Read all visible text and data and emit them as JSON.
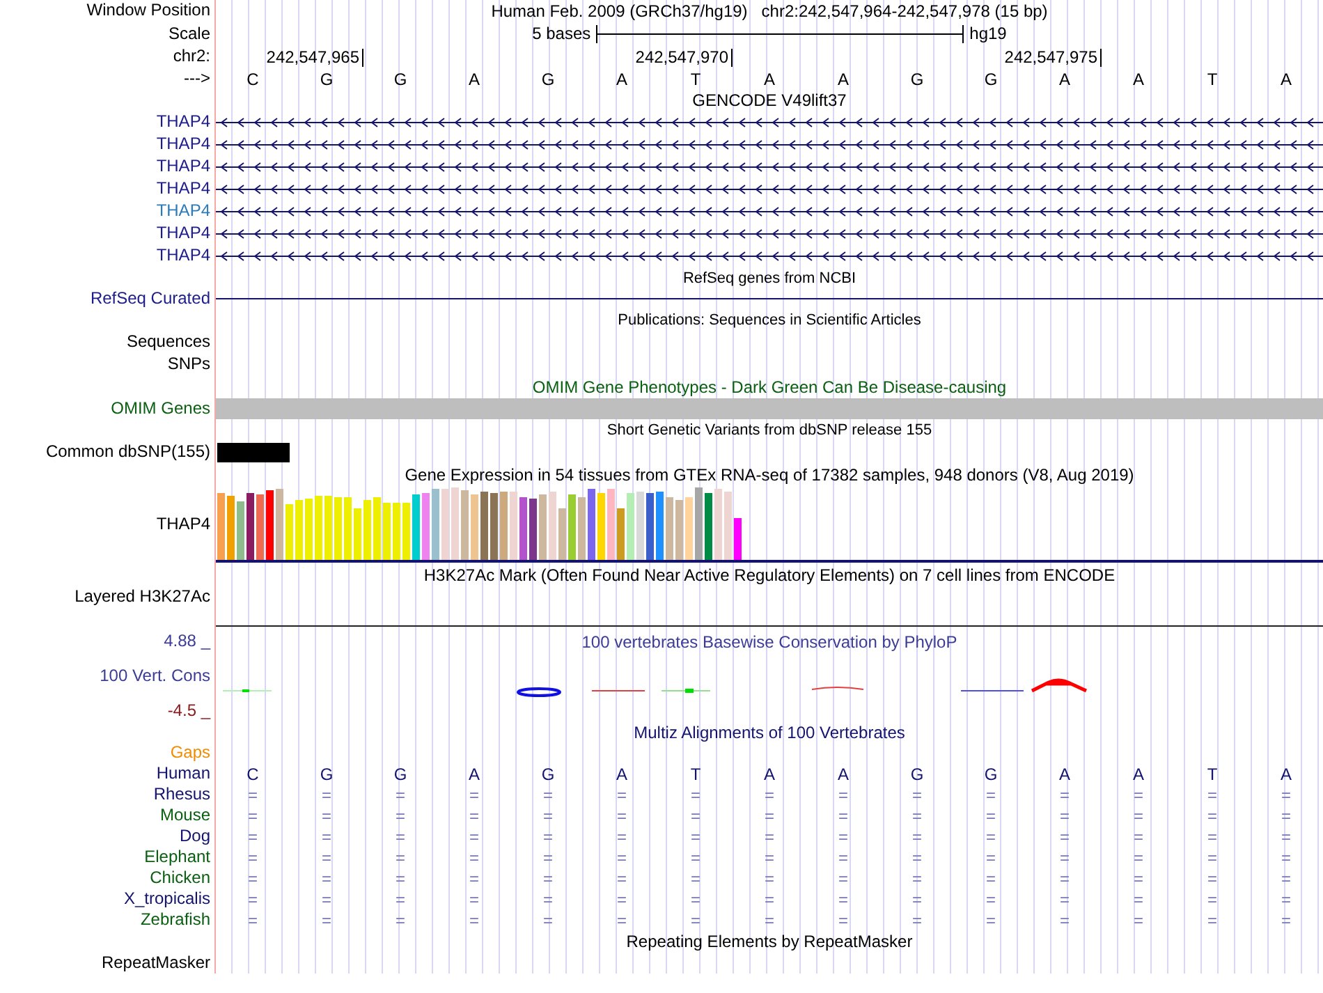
{
  "header": {
    "window_position_label": "Window Position",
    "assembly": "Human Feb. 2009 (GRCh37/hg19)",
    "position": "chr2:242,547,964-242,547,978 (15 bp)",
    "scale_label": "Scale",
    "scale_text": "5 bases",
    "scale_db": "hg19",
    "chrom_label": "chr2:",
    "ticks": [
      "242,547,965",
      "242,547,970",
      "242,547,975"
    ],
    "strand_label": "--->",
    "bases": [
      "C",
      "G",
      "G",
      "A",
      "G",
      "A",
      "T",
      "A",
      "A",
      "G",
      "G",
      "A",
      "A",
      "T",
      "A"
    ]
  },
  "tracks": [
    {
      "kind": "gene",
      "title": "GENCODE V49lift37",
      "color": "#000000",
      "rows": [
        {
          "label": "THAP4",
          "color": "#1c1c8a"
        },
        {
          "label": "THAP4",
          "color": "#1c1c8a"
        },
        {
          "label": "THAP4",
          "color": "#1c1c8a"
        },
        {
          "label": "THAP4",
          "color": "#1c1c8a"
        },
        {
          "label": "THAP4",
          "color": "#2b7bb9"
        },
        {
          "label": "THAP4",
          "color": "#1c1c8a"
        },
        {
          "label": "THAP4",
          "color": "#1c1c8a"
        }
      ]
    },
    {
      "kind": "line",
      "title": "RefSeq genes from NCBI",
      "color": "#000000",
      "rows": [
        {
          "label": "RefSeq Curated",
          "color": "#1c1c8a"
        }
      ]
    },
    {
      "kind": "empty",
      "title": "Publications: Sequences in Scientific Articles",
      "color": "#000000",
      "rows": [
        {
          "label": "Sequences",
          "color": "#000000"
        },
        {
          "label": "SNPs",
          "color": "#000000"
        }
      ]
    },
    {
      "kind": "bar",
      "title": "OMIM Gene Phenotypes - Dark Green Can Be Disease-causing",
      "color": "#0a6010",
      "rows": [
        {
          "label": "OMIM Genes",
          "color": "#0a6010"
        }
      ]
    },
    {
      "kind": "snp",
      "title": "Short Genetic Variants from dbSNP release 155",
      "color": "#000000",
      "rows": [
        {
          "label": "Common dbSNP(155)",
          "color": "#000000"
        }
      ]
    },
    {
      "kind": "expression",
      "title": "Gene Expression in 54 tissues from GTEx RNA-seq of 17382 samples, 948 donors (V8, Aug 2019)",
      "color": "#000000",
      "rows": [
        {
          "label": "THAP4",
          "color": "#000000"
        }
      ]
    },
    {
      "kind": "layered",
      "title": "H3K27Ac Mark (Often Found Near Active Regulatory Elements) on 7 cell lines from ENCODE",
      "color": "#000000",
      "rows": [
        {
          "label": "Layered H3K27Ac",
          "color": "#000000"
        }
      ]
    },
    {
      "kind": "wiggle",
      "title": "100 vertebrates Basewise Conservation by PhyloP",
      "color": "#3c3c96",
      "label": "100 Vert. Cons",
      "max": "4.88 _",
      "min": "-4.5 _"
    },
    {
      "kind": "multiz",
      "title": "Multiz Alignments of 100 Vertebrates",
      "color": "#14146e",
      "gaps_label": "Gaps",
      "species": [
        {
          "name": "Human",
          "color": "#14146e",
          "bases": [
            "C",
            "G",
            "G",
            "A",
            "G",
            "A",
            "T",
            "A",
            "A",
            "G",
            "G",
            "A",
            "A",
            "T",
            "A"
          ]
        },
        {
          "name": "Rhesus",
          "color": "#14146e",
          "bases": [
            "=",
            "=",
            "=",
            "=",
            "=",
            "=",
            "=",
            "=",
            "=",
            "=",
            "=",
            "=",
            "=",
            "=",
            "="
          ]
        },
        {
          "name": "Mouse",
          "color": "#0a6010",
          "bases": [
            "=",
            "=",
            "=",
            "=",
            "=",
            "=",
            "=",
            "=",
            "=",
            "=",
            "=",
            "=",
            "=",
            "=",
            "="
          ]
        },
        {
          "name": "Dog",
          "color": "#14146e",
          "bases": [
            "=",
            "=",
            "=",
            "=",
            "=",
            "=",
            "=",
            "=",
            "=",
            "=",
            "=",
            "=",
            "=",
            "=",
            "="
          ]
        },
        {
          "name": "Elephant",
          "color": "#0a6010",
          "bases": [
            "=",
            "=",
            "=",
            "=",
            "=",
            "=",
            "=",
            "=",
            "=",
            "=",
            "=",
            "=",
            "=",
            "=",
            "="
          ]
        },
        {
          "name": "Chicken",
          "color": "#0a6010",
          "bases": [
            "=",
            "=",
            "=",
            "=",
            "=",
            "=",
            "=",
            "=",
            "=",
            "=",
            "=",
            "=",
            "=",
            "=",
            "="
          ]
        },
        {
          "name": "X_tropicalis",
          "color": "#14146e",
          "bases": [
            "=",
            "=",
            "=",
            "=",
            "=",
            "=",
            "=",
            "=",
            "=",
            "=",
            "=",
            "=",
            "=",
            "=",
            "="
          ]
        },
        {
          "name": "Zebrafish",
          "color": "#0a6010",
          "bases": [
            "=",
            "=",
            "=",
            "=",
            "=",
            "=",
            "=",
            "=",
            "=",
            "=",
            "=",
            "=",
            "=",
            "=",
            "="
          ]
        }
      ]
    },
    {
      "kind": "empty",
      "title": "Repeating Elements by RepeatMasker",
      "color": "#000000",
      "rows": [
        {
          "label": "RepeatMasker",
          "color": "#000000"
        }
      ]
    }
  ]
}
